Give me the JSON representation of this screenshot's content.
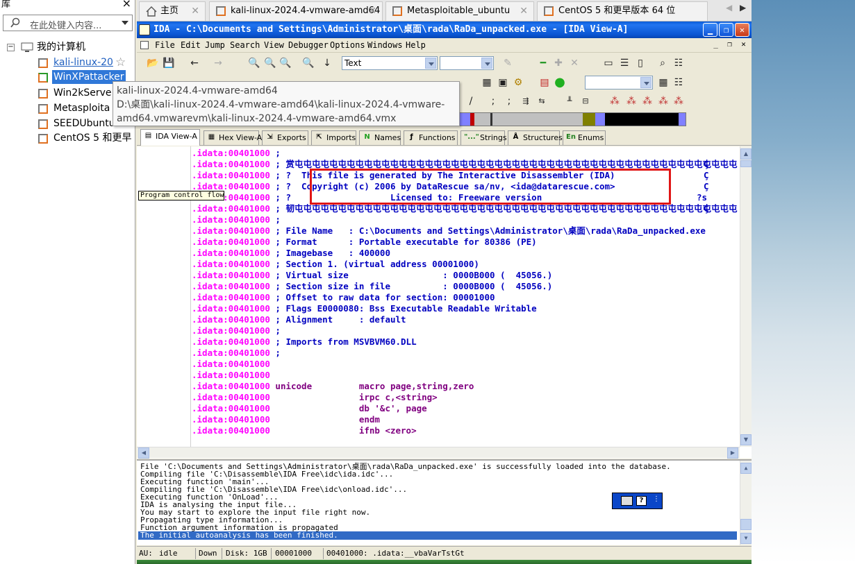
{
  "library": {
    "title": "库",
    "close": "×",
    "search_placeholder": "在此处键入内容...",
    "root": "我的计算机",
    "items": [
      {
        "label": "kali-linux-20"
      },
      {
        "label": "WinXPattacker"
      },
      {
        "label": "Win2kServe"
      },
      {
        "label": "Metasploita"
      },
      {
        "label": "SEEDUbuntu"
      },
      {
        "label": "CentOS 5 和更早"
      }
    ]
  },
  "hover_tooltip": {
    "line1": "kali-linux-2024.4-vmware-amd64",
    "line2": "D:\\桌面\\kali-linux-2024.4-vmware-amd64\\kali-linux-2024.4-vmware-",
    "line3": "amd64.vmwarevm\\kali-linux-2024.4-vmware-amd64.vmx"
  },
  "vm_tabs": [
    {
      "label": "主页"
    },
    {
      "label": "kali-linux-2024.4-vmware-amd64"
    },
    {
      "label": "Metasploitable_ubuntu"
    },
    {
      "label": "CentOS 5 和更早版本 64 位"
    }
  ],
  "ida": {
    "title": "IDA - C:\\Documents and Settings\\Administrator\\桌面\\rada\\RaDa_unpacked.exe - [IDA View-A]",
    "menu": [
      "File",
      "Edit",
      "Jump",
      "Search",
      "View",
      "Debugger",
      "Options",
      "Windows",
      "Help"
    ],
    "toolbar": {
      "text_combo": "Text"
    },
    "tabs": [
      "IDA View-A",
      "Hex View-A",
      "Exports",
      "Imports",
      "Names",
      "Functions",
      "Strings",
      "Structures",
      "Enums"
    ],
    "tab_icons": [
      "N",
      "\"...\"",
      "En"
    ],
    "tooltip": "Program control flow",
    "disasm": [
      {
        "addr": ".idata:00401000",
        "text": " ;"
      },
      {
        "addr": ".idata:00401000",
        "text": " ; 赏屯屯屯屯屯屯屯屯屯屯屯屯屯屯屯屯屯屯屯屯屯屯屯屯屯屯屯屯屯屯屯屯屯屯屯屯屯屯屯屯屯屯屯屯屯屯屯屯屯屯屯屯屯屯屯屯屯屯屯屯屯屯屯屯屯屯屯"
      },
      {
        "addr": ".idata:00401000",
        "text": " ; ?  This file is generated by The Interactive Disassembler (IDA)"
      },
      {
        "addr": ".idata:00401000",
        "text": " ; ?  Copyright (c) 2006 by DataRescue sa/nv, <ida@datarescue.com>"
      },
      {
        "addr": ".idata:00401000",
        "text": " ; ?                   Licensed to: Freeware version"
      },
      {
        "addr": ".idata:00401000",
        "text": " ; 韧屯屯屯屯屯屯屯屯屯屯屯屯屯屯屯屯屯屯屯屯屯屯屯屯屯屯屯屯屯屯屯屯屯屯屯屯屯屯屯屯屯屯屯屯屯屯屯屯屯屯屯屯屯屯屯屯屯屯屯屯屯屯屯屯屯屯屯"
      },
      {
        "addr": ".idata:00401000",
        "text": " ;"
      },
      {
        "addr": ".idata:00401000",
        "text": " ; File Name   : C:\\Documents and Settings\\Administrator\\桌面\\rada\\RaDa_unpacked.exe"
      },
      {
        "addr": ".idata:00401000",
        "text": " ; Format      : Portable executable for 80386 (PE)"
      },
      {
        "addr": ".idata:00401000",
        "text": " ; Imagebase   : 400000"
      },
      {
        "addr": ".idata:00401000",
        "text": " ; Section 1. (virtual address 00001000)"
      },
      {
        "addr": ".idata:00401000",
        "text": " ; Virtual size                  : 0000B000 (  45056.)"
      },
      {
        "addr": ".idata:00401000",
        "text": " ; Section size in file          : 0000B000 (  45056.)"
      },
      {
        "addr": ".idata:00401000",
        "text": " ; Offset to raw data for section: 00001000"
      },
      {
        "addr": ".idata:00401000",
        "text": " ; Flags E0000080: Bss Executable Readable Writable"
      },
      {
        "addr": ".idata:00401000",
        "text": " ; Alignment     : default"
      },
      {
        "addr": ".idata:00401000",
        "text": " ;"
      },
      {
        "addr": ".idata:00401000",
        "text": " ; Imports from MSVBVM60.DLL"
      },
      {
        "addr": ".idata:00401000",
        "text": " ;"
      },
      {
        "addr": ".idata:00401000",
        "text": ""
      },
      {
        "addr": ".idata:00401000",
        "text": ""
      },
      {
        "addr": ".idata:00401000",
        "code": " unicode         macro page,string,zero"
      },
      {
        "addr": ".idata:00401000",
        "code": "                 irpc c,<string>"
      },
      {
        "addr": ".idata:00401000",
        "code": "                 db '&c', page"
      },
      {
        "addr": ".idata:00401000",
        "code": "                 endm"
      },
      {
        "addr": ".idata:00401000",
        "code": "                 ifnb <zero>"
      }
    ],
    "right_edge_marks": [
      "Ç",
      "Ç",
      "Ç",
      "?s",
      "Ç"
    ],
    "output": [
      "File 'C:\\Documents and Settings\\Administrator\\桌面\\rada\\RaDa_unpacked.exe' is successfully loaded into the database.",
      "Compiling file 'C:\\Disassemble\\IDA Free\\idc\\ida.idc'...",
      "Executing function 'main'...",
      "Compiling file 'C:\\Disassemble\\IDA Free\\idc\\onload.idc'...",
      "Executing function 'OnLoad'...",
      "IDA is analysing the input file...",
      "You may start to explore the input file right now.",
      "Propagating type information...",
      "Function argument information is propagated",
      "The initial autoanalysis has been finished."
    ],
    "status": {
      "au_label": "AU:",
      "au_value": "idle",
      "dir": "Down",
      "disk": "Disk: 1GB",
      "offset": "00001000",
      "location": "00401000: .idata:__vbaVarTstGt"
    }
  },
  "colors": {
    "addr": "#ff00ff",
    "comment": "#0000c0",
    "code": "#800080",
    "highlight_box": "#e01515",
    "selection": "#316ac5"
  }
}
